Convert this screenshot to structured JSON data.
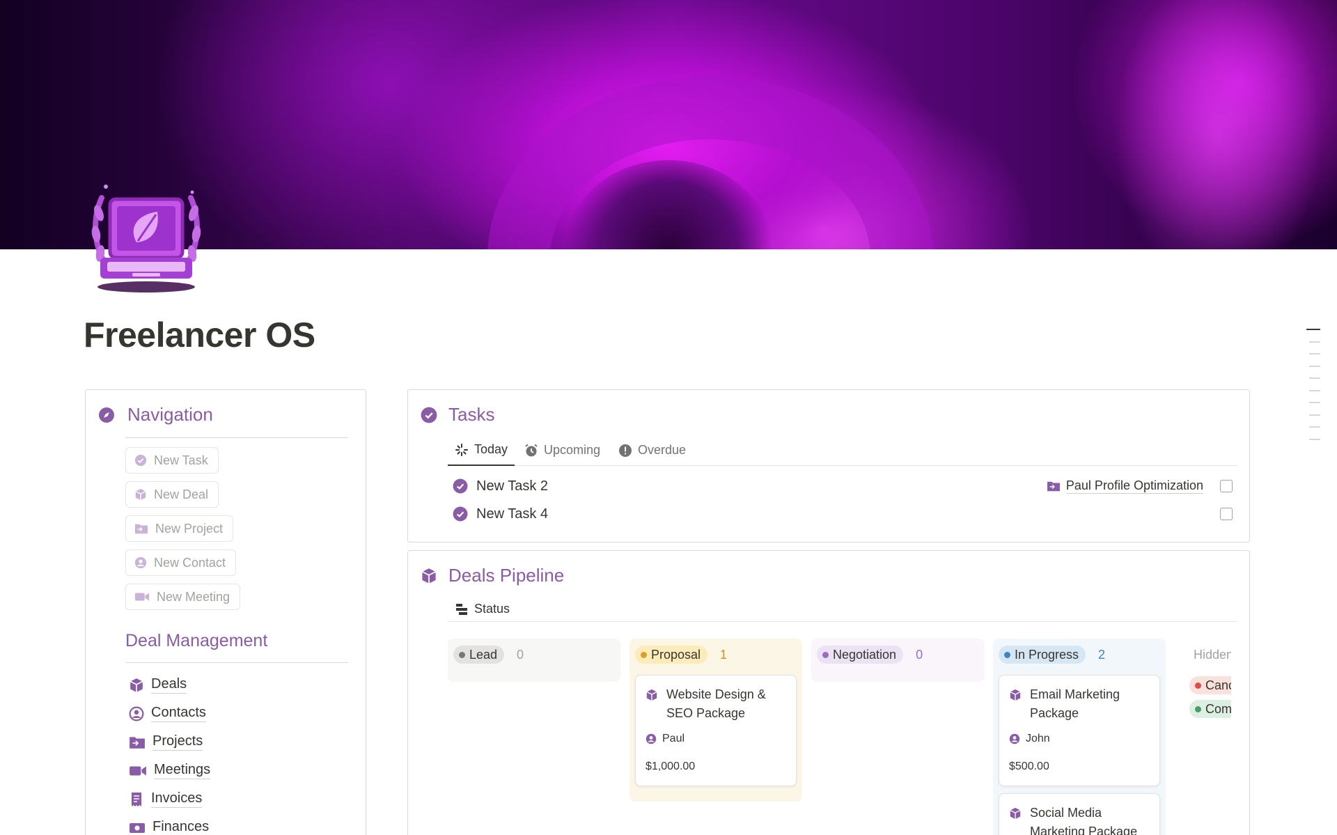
{
  "page": {
    "title": "Freelancer OS",
    "icon": "laptop-leaf-icon"
  },
  "navigation": {
    "title": "Navigation",
    "icon": "compass-icon",
    "buttons": [
      {
        "label": "New Task",
        "icon": "check-circle-icon"
      },
      {
        "label": "New Deal",
        "icon": "cube-icon"
      },
      {
        "label": "New Project",
        "icon": "folder-icon"
      },
      {
        "label": "New Contact",
        "icon": "user-circle-icon"
      },
      {
        "label": "New Meeting",
        "icon": "video-icon"
      }
    ],
    "deal_management": {
      "title": "Deal Management",
      "links": [
        {
          "label": "Deals",
          "icon": "cube-icon"
        },
        {
          "label": "Contacts",
          "icon": "user-circle-icon"
        },
        {
          "label": "Projects",
          "icon": "folder-icon"
        },
        {
          "label": "Meetings",
          "icon": "video-icon"
        },
        {
          "label": "Invoices",
          "icon": "receipt-icon"
        },
        {
          "label": "Finances",
          "icon": "money-icon"
        }
      ]
    }
  },
  "tasks": {
    "title": "Tasks",
    "icon": "check-circle-icon",
    "tabs": [
      {
        "label": "Today",
        "icon": "sparkle-loader-icon",
        "active": true
      },
      {
        "label": "Upcoming",
        "icon": "alarm-clock-icon",
        "active": false
      },
      {
        "label": "Overdue",
        "icon": "alert-icon",
        "active": false
      }
    ],
    "rows": [
      {
        "name": "New Task 2",
        "project": "Paul Profile Optimization",
        "done": false
      },
      {
        "name": "New Task 4",
        "project": "",
        "done": false
      }
    ]
  },
  "deals": {
    "title": "Deals Pipeline",
    "icon": "cube-icon",
    "group_by_label": "Status",
    "columns": [
      {
        "status": "Lead",
        "count": "0",
        "pill_bg": "#e3e2e0",
        "dot": "#787774",
        "col_bg": "#f7f7f5",
        "count_color": "#a3a29e",
        "cards": []
      },
      {
        "status": "Proposal",
        "count": "1",
        "pill_bg": "#fbecba",
        "dot": "#d9a12a",
        "col_bg": "#fbf6e6",
        "count_color": "#c8951b",
        "cards": [
          {
            "title": "Website Design & SEO Package",
            "person": "Paul",
            "amount": "$1,000.00"
          }
        ]
      },
      {
        "status": "Negotiation",
        "count": "0",
        "pill_bg": "#ebe2f3",
        "dot": "#9a6dbb",
        "col_bg": "#f9f5fb",
        "count_color": "#9a6dbb",
        "cards": []
      },
      {
        "status": "In Progress",
        "count": "2",
        "pill_bg": "#d6e7f3",
        "dot": "#3f84c0",
        "col_bg": "#f1f7fb",
        "count_color": "#3f84c0",
        "cards": [
          {
            "title": "Email Marketing Package",
            "person": "John",
            "amount": "$500.00"
          },
          {
            "title": "Social Media Marketing Package",
            "person": "",
            "amount": ""
          }
        ]
      }
    ],
    "hidden": {
      "label": "Hidden",
      "groups": [
        {
          "status": "Canceled",
          "pill_bg": "#fbe1de",
          "dot": "#d8504a"
        },
        {
          "status": "Completed",
          "pill_bg": "#dcefe2",
          "dot": "#4c9a68"
        }
      ]
    }
  },
  "colors": {
    "accent": "#8a5ba6",
    "text": "#37352f"
  }
}
